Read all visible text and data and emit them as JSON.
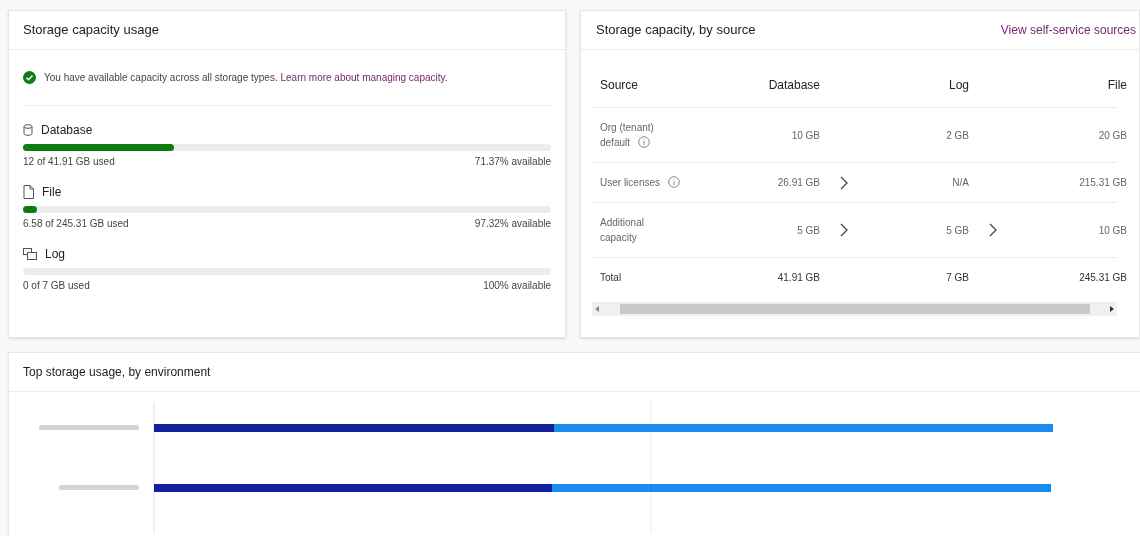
{
  "usage_card": {
    "title": "Storage capacity usage",
    "status": {
      "ok": true,
      "message": "You have available capacity across all storage types.",
      "link": "Learn more about managing capacity."
    },
    "types": [
      {
        "kind": "database",
        "name": "Database",
        "level": 0.286,
        "used": "12 of 41.91 GB used",
        "available": "71.37% available"
      },
      {
        "kind": "file",
        "name": "File",
        "level": 0.027,
        "used": "6.58 of 245.31 GB used",
        "available": "97.32% available"
      },
      {
        "kind": "log",
        "name": "Log",
        "level": 0,
        "used": "0 of 7 GB used",
        "available": "100% available"
      }
    ]
  },
  "source_card": {
    "title": "Storage capacity, by source",
    "link": "View self-service sources",
    "columns": [
      "Source",
      "Database",
      "Log",
      "File"
    ],
    "rows": [
      {
        "kind": "normal",
        "source": "Org (tenant) default",
        "info": true,
        "database": "10 GB",
        "database_link": false,
        "log": "2 GB",
        "log_link": false,
        "file": "20 GB"
      },
      {
        "kind": "normal",
        "source": "User licenses",
        "info": true,
        "database": "26.91 GB",
        "database_link": true,
        "log": "N/A",
        "log_link": false,
        "file": "215.31 GB"
      },
      {
        "kind": "normal",
        "source": "Additional capacity",
        "info": false,
        "database": "5 GB",
        "database_link": true,
        "log": "5 GB",
        "log_link": true,
        "file": "10 GB"
      },
      {
        "kind": "total",
        "source": "Total",
        "info": false,
        "database": "41.91 GB",
        "database_link": false,
        "log": "7 GB",
        "log_link": false,
        "file": "245.31 GB"
      }
    ]
  },
  "environment_card": {
    "title": "Top storage usage, by environment"
  }
}
